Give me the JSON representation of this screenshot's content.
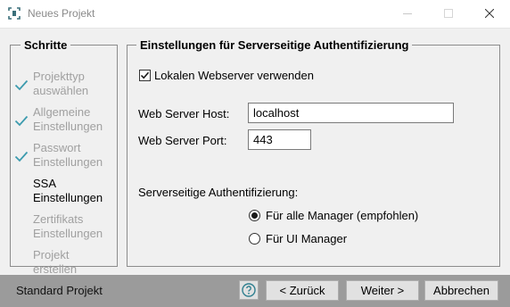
{
  "window": {
    "title": "Neues Projekt",
    "icon": "project-icon"
  },
  "steps": {
    "legend": "Schritte",
    "items": [
      {
        "label": "Projekttyp\nauswählen",
        "state": "done"
      },
      {
        "label": "Allgemeine\nEinstellungen",
        "state": "done"
      },
      {
        "label": "Passwort\nEinstellungen",
        "state": "done"
      },
      {
        "label": "SSA\nEinstellungen",
        "state": "current"
      },
      {
        "label": "Zertifikats\nEinstellungen",
        "state": "pending"
      },
      {
        "label": "Projekt\nerstellen",
        "state": "pending"
      }
    ],
    "check_color": "#3c9bae"
  },
  "settings": {
    "legend": "Einstellungen für Serverseitige Authentifizierung",
    "local_webserver": {
      "label": "Lokalen Webserver verwenden",
      "checked": true
    },
    "host": {
      "label": "Web Server Host:",
      "value": "localhost"
    },
    "port": {
      "label": "Web Server Port:",
      "value": "443"
    },
    "auth": {
      "label": "Serverseitige Authentifizierung:",
      "options": [
        {
          "label": "Für alle Manager (empfohlen)",
          "selected": true
        },
        {
          "label": "Für UI Manager",
          "selected": false
        }
      ]
    }
  },
  "footer": {
    "text": "Standard Projekt",
    "back_label": "< Zurück",
    "next_label": "Weiter >",
    "cancel_label": "Abbrechen",
    "help_icon": "help-icon"
  }
}
